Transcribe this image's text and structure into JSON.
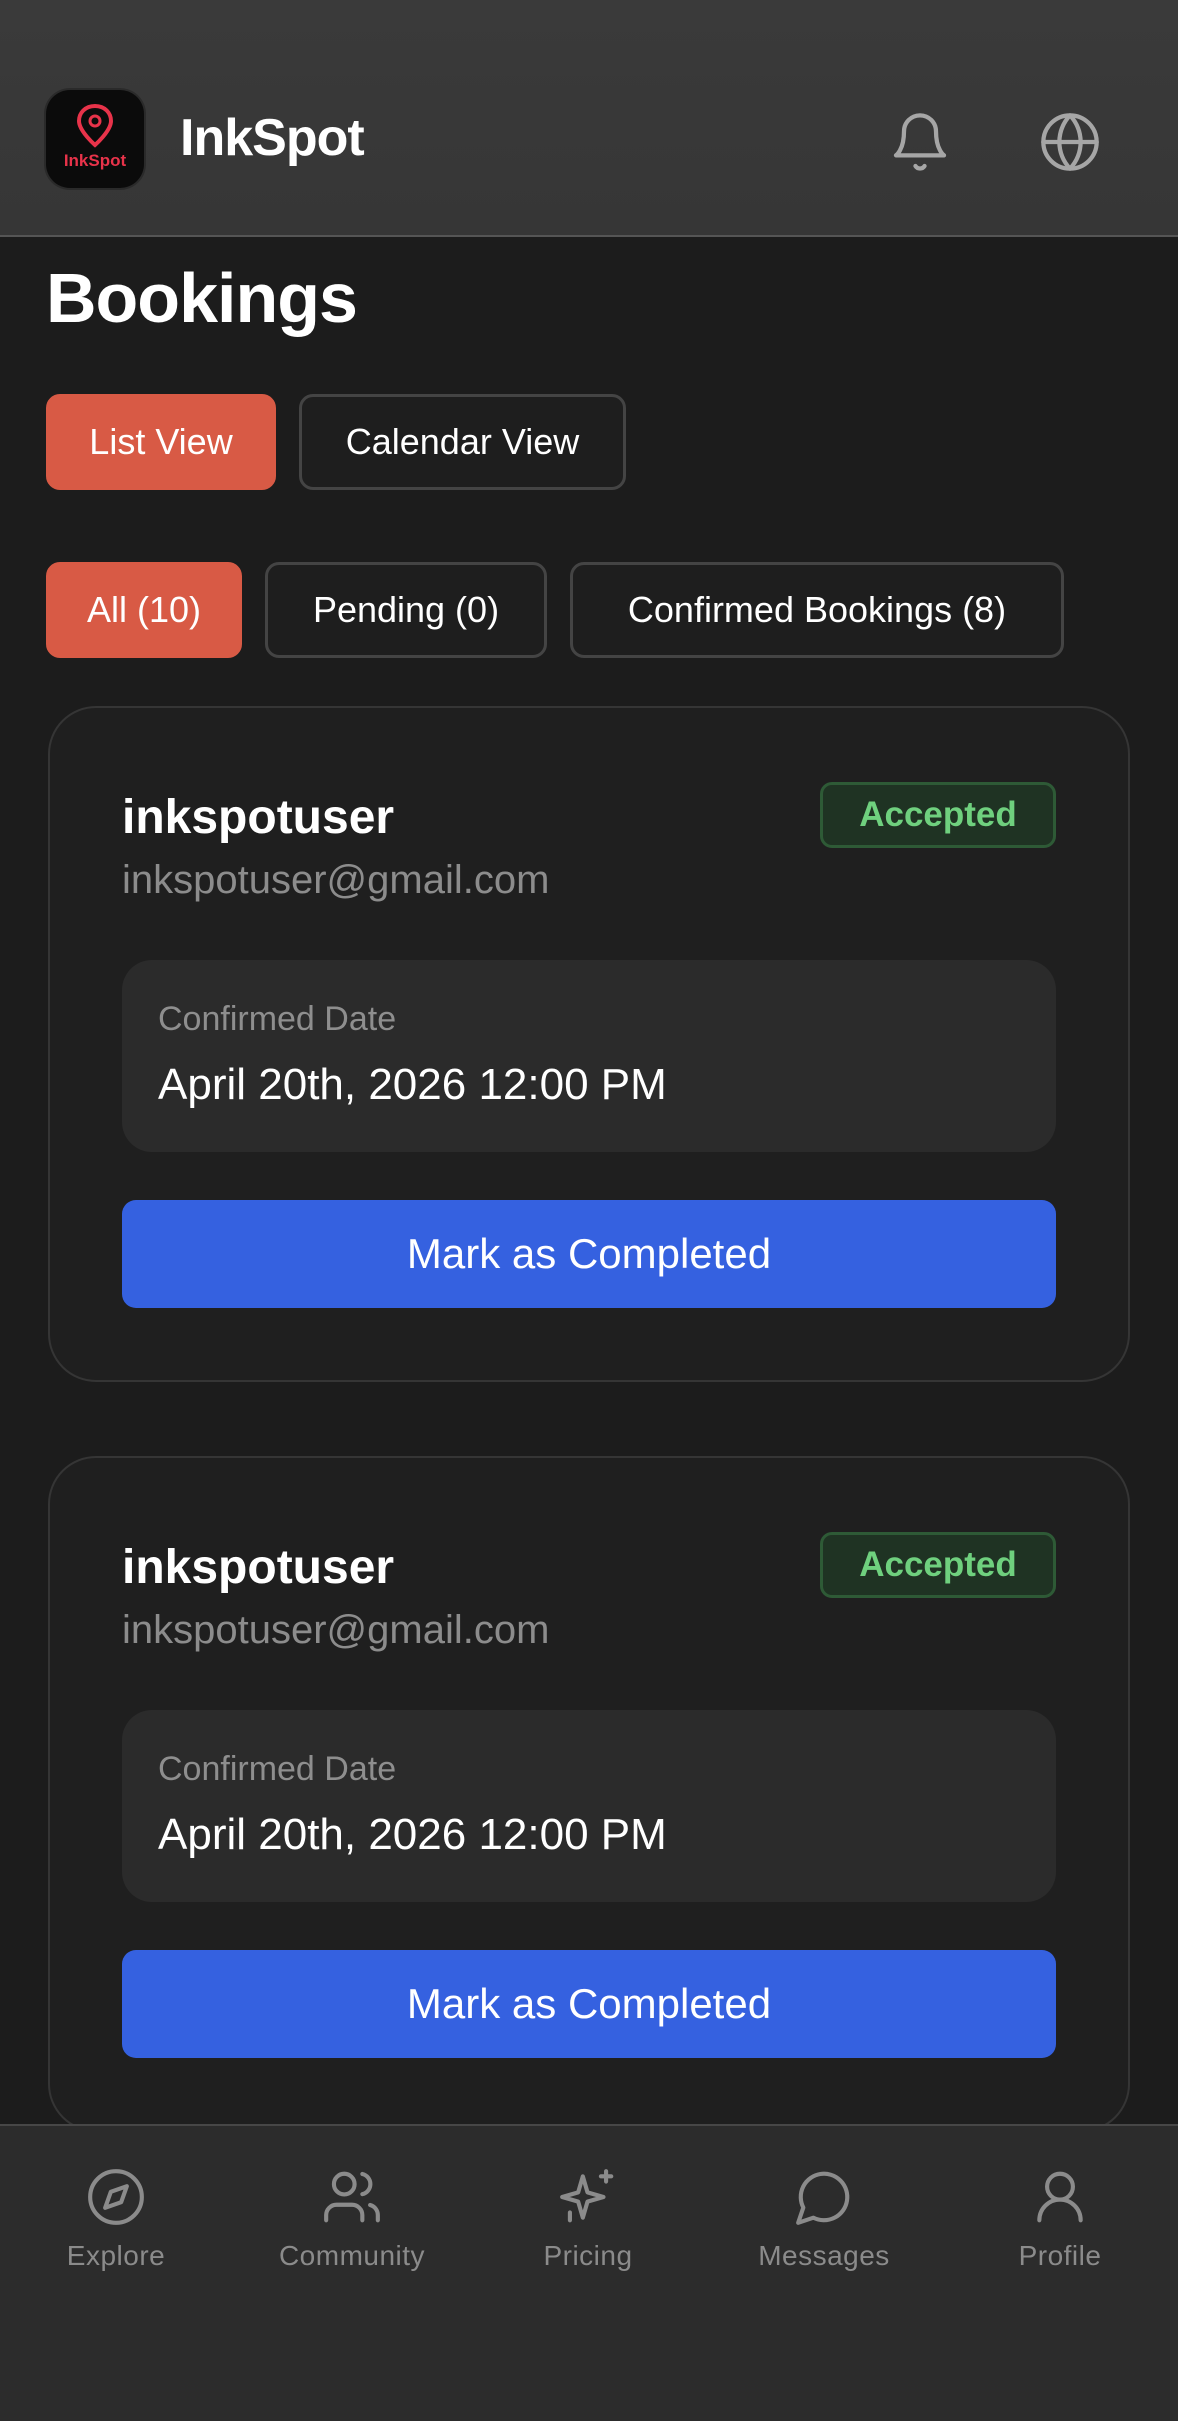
{
  "header": {
    "app_title": "InkSpot",
    "logo_text": "InkSpot",
    "icons": [
      "bell-icon",
      "globe-icon"
    ]
  },
  "page": {
    "title": "Bookings"
  },
  "view_toggle": {
    "list_label": "List View",
    "calendar_label": "Calendar View",
    "active": "List View"
  },
  "filters": {
    "all_label": "All (10)",
    "pending_label": "Pending (0)",
    "confirmed_label": "Confirmed Bookings (8)",
    "active": "All (10)"
  },
  "bookings": [
    {
      "username": "inkspotuser",
      "email": "inkspotuser@gmail.com",
      "status": "Accepted",
      "date_label": "Confirmed Date",
      "date_value": "April 20th, 2026 12:00 PM",
      "action_label": "Mark as Completed"
    },
    {
      "username": "inkspotuser",
      "email": "inkspotuser@gmail.com",
      "status": "Accepted",
      "date_label": "Confirmed Date",
      "date_value": "April 20th, 2026 12:00 PM",
      "action_label": "Mark as Completed"
    }
  ],
  "tabbar": {
    "items": [
      {
        "label": "Explore",
        "icon": "compass-icon"
      },
      {
        "label": "Community",
        "icon": "users-icon"
      },
      {
        "label": "Pricing",
        "icon": "sparkles-icon"
      },
      {
        "label": "Messages",
        "icon": "chat-bubble-icon"
      },
      {
        "label": "Profile",
        "icon": "user-icon"
      }
    ]
  },
  "colors": {
    "background": "#1c1c1c",
    "accent": "#d85a45",
    "primary_button": "#3561e0",
    "status_accepted": "#6fd07e",
    "logo_red": "#e8334a"
  }
}
